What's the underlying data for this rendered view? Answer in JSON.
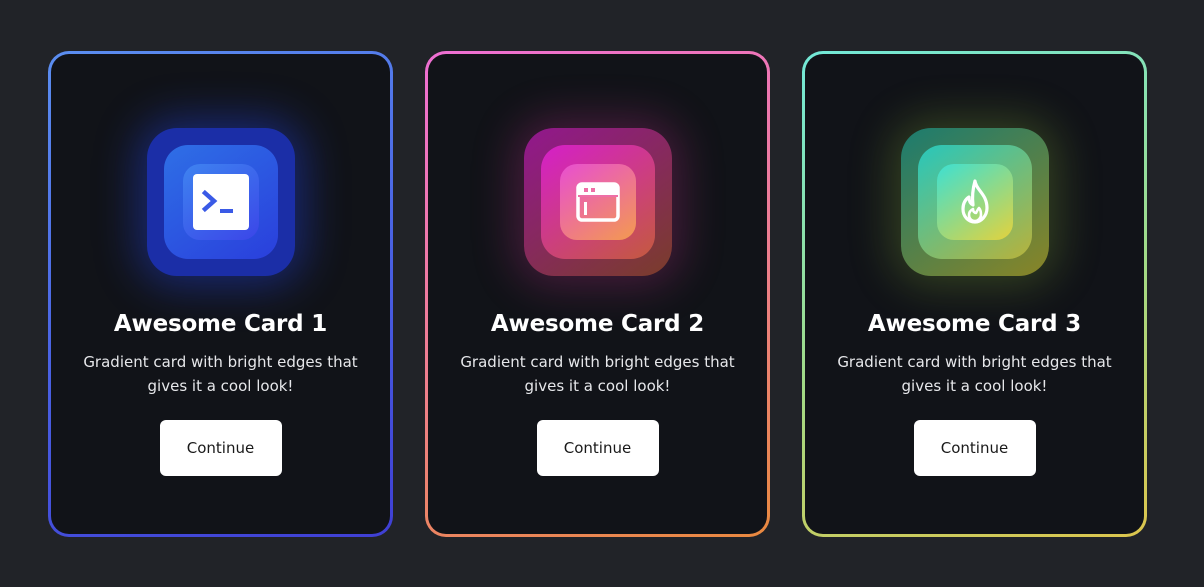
{
  "cards": [
    {
      "title": "Awesome Card 1",
      "description": "Gradient card with bright edges that gives it a cool look!",
      "button_label": "Continue",
      "icon": "terminal-icon",
      "accent": "#4a63e3"
    },
    {
      "title": "Awesome Card 2",
      "description": "Gradient card with bright edges that gives it a cool look!",
      "button_label": "Continue",
      "icon": "browser-window-icon",
      "accent": "#ee7f8c"
    },
    {
      "title": "Awesome Card 3",
      "description": "Gradient card with bright edges that gives it a cool look!",
      "button_label": "Continue",
      "icon": "flame-icon",
      "accent": "#a2da86"
    }
  ]
}
